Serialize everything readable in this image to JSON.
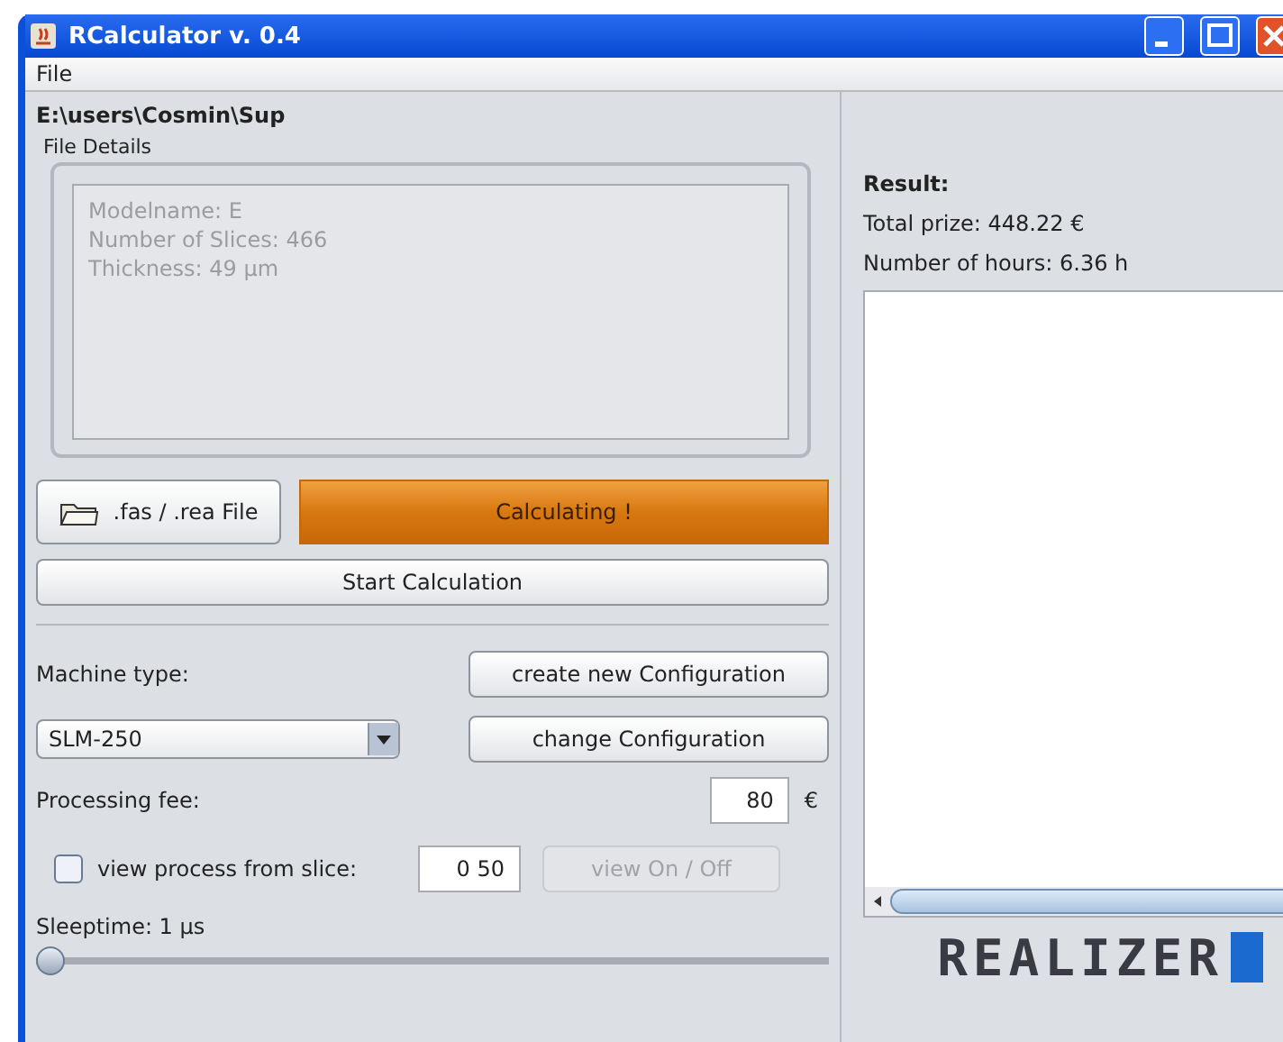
{
  "window": {
    "title": "RCalculator v. 0.4"
  },
  "menu": [
    "File"
  ],
  "file_path": "E:\\users\\Cosmin\\Sup",
  "file_details": {
    "title": "File Details",
    "lines": [
      "Modelname: E",
      "Number of Slices: 466",
      "Thickness: 49 µm"
    ]
  },
  "file_button": {
    "label": ".fas / .rea File"
  },
  "calculating_button": {
    "label": "Calculating !",
    "active": true
  },
  "start_button": {
    "label": "Start Calculation"
  },
  "machine": {
    "label": "Machine type:",
    "value": "SLM-250"
  },
  "config_buttons": [
    "create new Configuration",
    "change Configuration"
  ],
  "fee": {
    "label": "Processing fee:",
    "value": "80",
    "unit": "€"
  },
  "view_process": {
    "label": "view process from slice:",
    "checked": false,
    "value": "0 50",
    "button": "view On / Off",
    "button_disabled": true
  },
  "sleeptime": {
    "label": "Sleeptime: 1 µs",
    "level": 0
  },
  "result": {
    "title": "Result:",
    "lines": [
      "Total prize: 448.22 €",
      "Number of hours: 6.36 h"
    ]
  },
  "logo": {
    "text": "REALIZER"
  }
}
